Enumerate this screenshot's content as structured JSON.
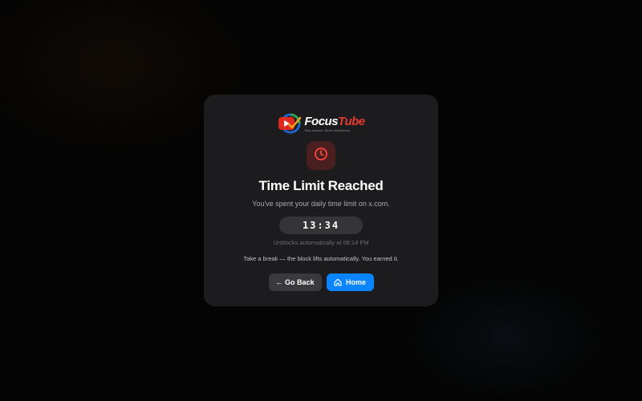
{
  "logo": {
    "word_part1": "Focus",
    "word_part2": "Tube",
    "tagline": "Stay focused. Block distractions."
  },
  "block": {
    "title": "Time Limit Reached",
    "subtitle": "You've spent your daily time limit on x.com.",
    "timer": "13:34",
    "unblocks": "Unblocks automatically at 08:14 PM",
    "note": "Take a break — the block lifts automatically. You earned it."
  },
  "buttons": {
    "back_label": "← Go Back",
    "home_label": "Home"
  },
  "colors": {
    "accent_blue": "#0a84ff",
    "clock_red": "#ff453a",
    "card_bg": "#1c1c1e"
  },
  "icons": {
    "logo": "focustube-logo-icon",
    "clock": "clock-icon",
    "home": "home-icon"
  }
}
